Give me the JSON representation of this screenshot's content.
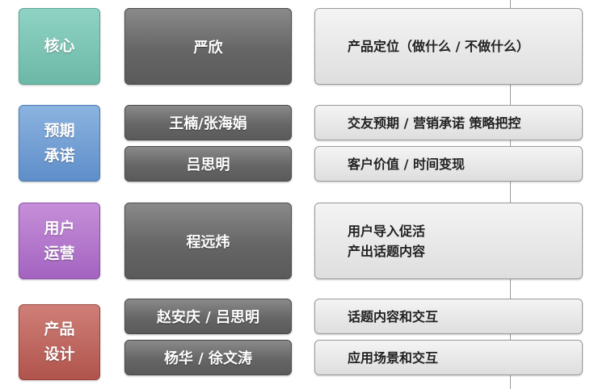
{
  "groups": [
    {
      "category": "核心",
      "rows": [
        {
          "person": "严欣",
          "task": "产品定位（做什么 / 不做什么）"
        }
      ]
    },
    {
      "category": "预期\n承诺",
      "rows": [
        {
          "person": "王楠/张海娟",
          "task": "交友预期 / 营销承诺 策略把控"
        },
        {
          "person": "吕思明",
          "task": "客户价值 / 时间变现"
        }
      ]
    },
    {
      "category": "用户\n运营",
      "rows": [
        {
          "person": "程远炜",
          "task": "用户导入促活\n产出话题内容"
        }
      ]
    },
    {
      "category": "产品\n设计",
      "rows": [
        {
          "person": "赵安庆 / 吕思明",
          "task": "话题内容和交互"
        },
        {
          "person": "杨华 / 徐文涛",
          "task": "应用场景和交互"
        }
      ]
    }
  ]
}
